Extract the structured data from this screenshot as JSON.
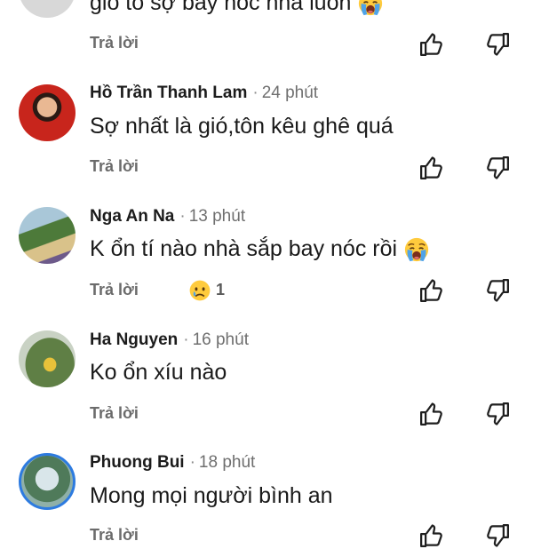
{
  "comments": [
    {
      "author": "",
      "time": "",
      "text": "gió to sợ bay nóc nhà luôn",
      "reply_label": "Trả lời"
    },
    {
      "author": "Hồ Trần Thanh Lam",
      "time": "24 phút",
      "text": "Sợ nhất là gió,tôn kêu ghê quá",
      "reply_label": "Trả lời"
    },
    {
      "author": "Nga An Na",
      "time": "13 phút",
      "text": "K ổn tí nào nhà sắp bay nóc rồi",
      "reply_label": "Trả lời",
      "reaction_count": "1"
    },
    {
      "author": "Ha Nguyen",
      "time": "16 phút",
      "text": "Ko ổn xíu nào",
      "reply_label": "Trả lời"
    },
    {
      "author": "Phuong Bui",
      "time": "18 phút",
      "text": "Mong mọi người bình an",
      "reply_label": "Trả lời"
    }
  ],
  "icons": {
    "like": "thumbs-up-outline-icon",
    "dislike": "thumbs-down-outline-icon",
    "crying": "loudly-crying-face-emoji",
    "sad": "sad-face-emoji"
  },
  "colors": {
    "author": "#1c1c1c",
    "meta": "#6f6f6f",
    "reply": "#6b6b6b"
  }
}
